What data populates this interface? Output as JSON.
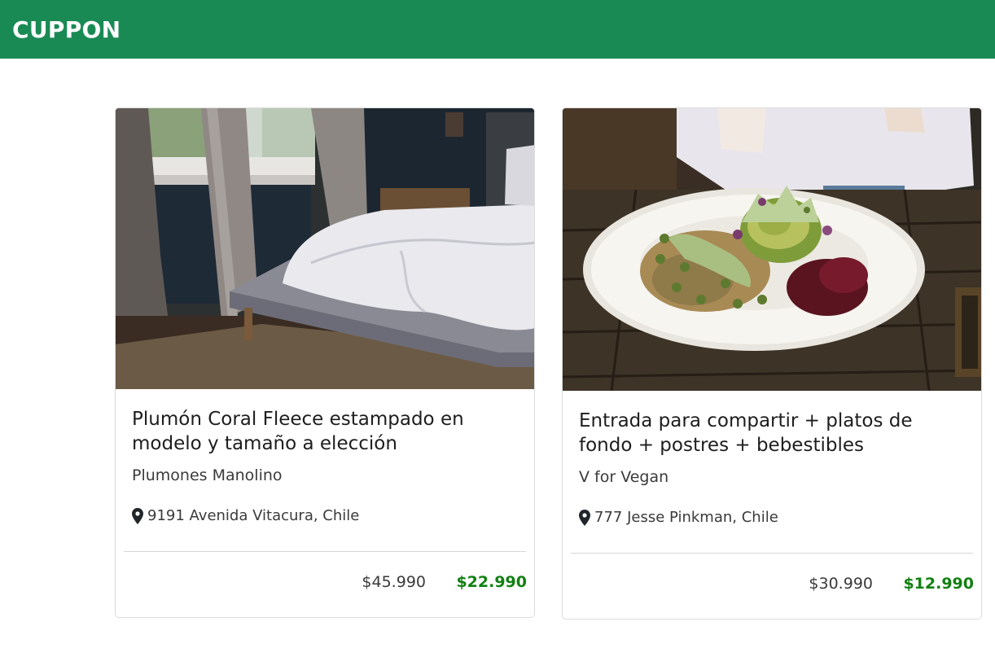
{
  "header": {
    "brand": "CUPPON"
  },
  "deals": [
    {
      "title": "Plumón Coral Fleece estampado en modelo y tamaño a elección",
      "merchant": "Plumones Manolino",
      "address": "9191 Avenida Vitacura, Chile",
      "original_price": "$45.990",
      "discount_price": "$22.990"
    },
    {
      "title": "Entrada para compartir + platos de fondo + postres + bebestibles",
      "merchant": "V for Vegan",
      "address": "777 Jesse Pinkman, Chile",
      "original_price": "$30.990",
      "discount_price": "$12.990"
    }
  ],
  "icons": {
    "location": "map-marker-icon"
  },
  "colors": {
    "header_bg": "#1a8a55",
    "discount_price": "#128012"
  }
}
